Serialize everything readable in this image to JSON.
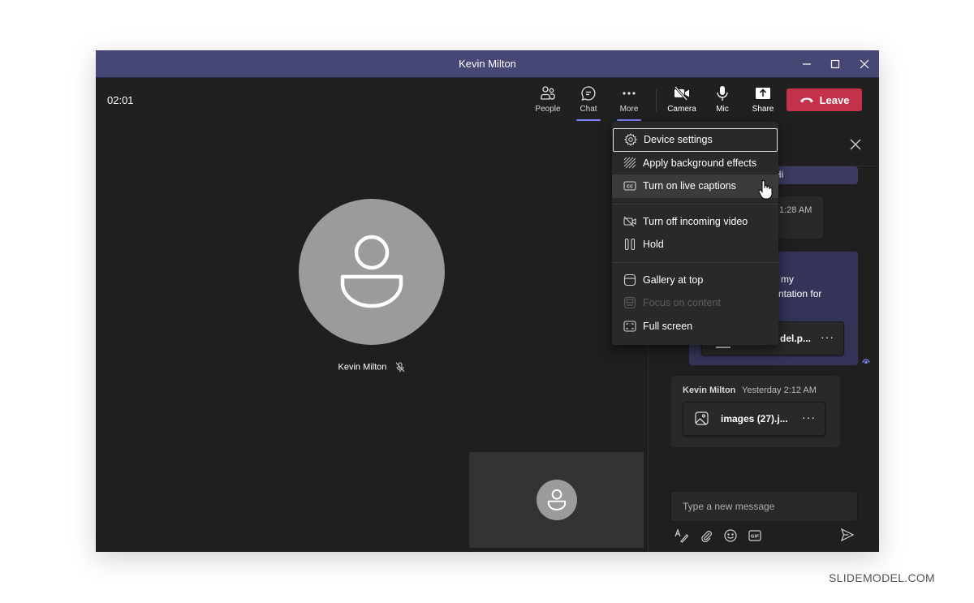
{
  "window": {
    "title": "Kevin Milton",
    "controls": {
      "minimize": "minimize",
      "maximize": "maximize",
      "close": "close"
    }
  },
  "toolbar": {
    "timer": "02:01",
    "buttons": [
      {
        "id": "people",
        "label": "People",
        "icon": "people-icon",
        "active": false
      },
      {
        "id": "chat",
        "label": "Chat",
        "icon": "chat-icon",
        "active": true
      },
      {
        "id": "more",
        "label": "More",
        "icon": "more-icon",
        "active": true
      },
      {
        "id": "camera",
        "label": "Camera",
        "icon": "camera-off-icon",
        "active": false
      },
      {
        "id": "mic",
        "label": "Mic",
        "icon": "mic-icon",
        "active": false
      },
      {
        "id": "share",
        "label": "Share",
        "icon": "share-icon",
        "active": false
      }
    ],
    "leave_label": "Leave",
    "leave_color": "#c4314b"
  },
  "stage": {
    "participant_name": "Kevin Milton",
    "participant_muted": true
  },
  "more_menu": {
    "groups": [
      [
        {
          "label": "Device settings",
          "icon": "gear-icon",
          "state": "focused"
        },
        {
          "label": "Apply background effects",
          "icon": "background-effects-icon",
          "state": "normal"
        },
        {
          "label": "Turn on live captions",
          "icon": "closed-captions-icon",
          "state": "hover"
        }
      ],
      [
        {
          "label": "Turn off incoming video",
          "icon": "video-off-icon",
          "state": "normal"
        },
        {
          "label": "Hold",
          "icon": "pause-icon",
          "state": "normal"
        }
      ],
      [
        {
          "label": "Gallery at top",
          "icon": "gallery-top-icon",
          "state": "normal"
        },
        {
          "label": "Focus on content",
          "icon": "focus-content-icon",
          "state": "disabled"
        },
        {
          "label": "Full screen",
          "icon": "fullscreen-icon",
          "state": "normal"
        }
      ]
    ]
  },
  "chat": {
    "messages": [
      {
        "type": "sent",
        "text_visible": "Hi"
      },
      {
        "type": "received",
        "time_visible": "1:28 AM"
      },
      {
        "type": "sent",
        "text_line1_visible": "my",
        "text_line2_visible": "ntation for",
        "attachment_visible": "del.p..."
      },
      {
        "type": "received",
        "sender": "Kevin Milton",
        "time": "Yesterday 2:12 AM",
        "attachment": "images (27).j..."
      }
    ],
    "compose_placeholder": "Type a new message",
    "accent": "#7f85f5"
  },
  "watermark": "SLIDEMODEL.COM"
}
